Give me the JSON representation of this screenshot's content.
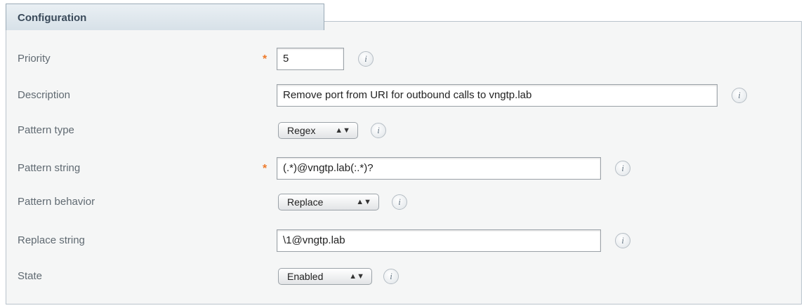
{
  "section": {
    "title": "Configuration"
  },
  "fields": {
    "priority": {
      "label": "Priority",
      "value": "5",
      "required": true
    },
    "description": {
      "label": "Description",
      "value": "Remove port from URI for outbound calls to vngtp.lab"
    },
    "pattern_type": {
      "label": "Pattern type",
      "value": "Regex"
    },
    "pattern_string": {
      "label": "Pattern string",
      "value": "(.*)@vngtp.lab(:.*)?",
      "required": true
    },
    "pattern_behavior": {
      "label": "Pattern behavior",
      "value": "Replace"
    },
    "replace_string": {
      "label": "Replace string",
      "value": "\\1@vngtp.lab"
    },
    "state": {
      "label": "State",
      "value": "Enabled"
    }
  },
  "icons": {
    "required_marker": "asterisk",
    "info": "info-icon",
    "select_arrows": "up-down-arrows-icon"
  },
  "colors": {
    "required": "#ee7a2a",
    "panel_border": "#b9c3cc",
    "tab_background": "#dfe7ed",
    "label_text": "#606a72"
  }
}
